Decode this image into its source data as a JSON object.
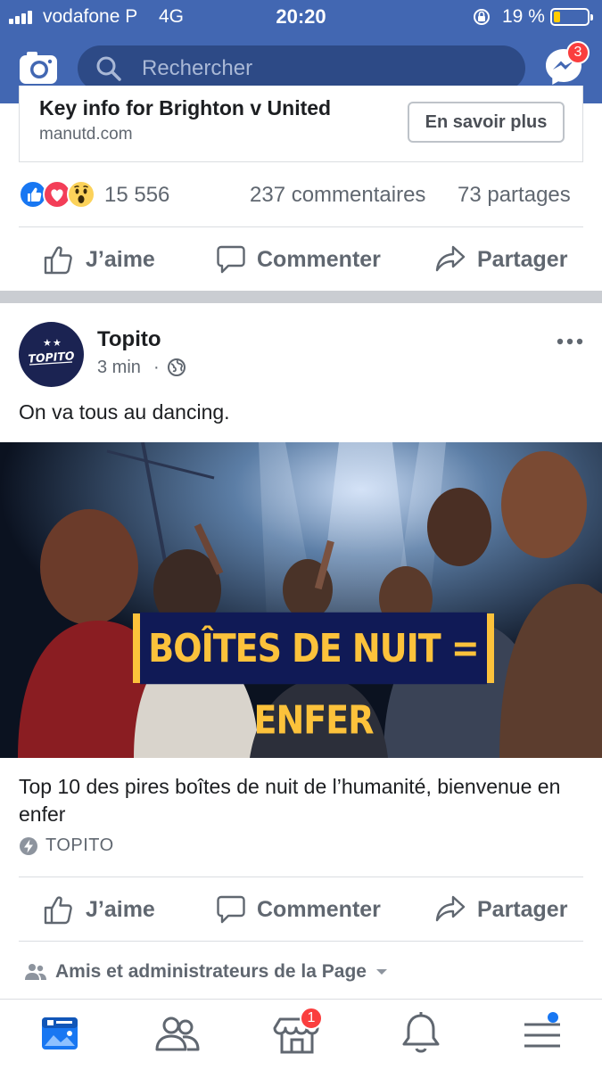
{
  "status_bar": {
    "carrier": "vodafone P",
    "network": "4G",
    "time": "20:20",
    "battery_percent": "19 %",
    "battery_level": 0.19
  },
  "header": {
    "search_placeholder": "Rechercher",
    "messenger_badge": "3",
    "bar_color": "#4267b2"
  },
  "previous_post": {
    "link_title": "Key info for Brighton v United",
    "link_domain": "manutd.com",
    "cta_label": "En savoir plus",
    "reaction_icons": [
      "like",
      "love",
      "wow"
    ],
    "reaction_count": "15 556",
    "comments": "237 commentaires",
    "shares": "73 partages",
    "actions": {
      "like": "J’aime",
      "comment": "Commenter",
      "share": "Partager"
    }
  },
  "post": {
    "page_name": "Topito",
    "avatar_text": "TOPITO",
    "time": "3 min",
    "separator": "·",
    "privacy_icon": "globe-icon",
    "text": "On va tous au dancing.",
    "image_headline": "BOÎTES DE NUIT = ENFER",
    "article_title": "Top 10 des pires boîtes de nuit de l’humanité, bienvenue en enfer",
    "source": "TOPITO",
    "actions": {
      "like": "J’aime",
      "comment": "Commenter",
      "share": "Partager"
    },
    "audience": "Amis et administrateurs de la Page"
  },
  "tabbar": {
    "tabs": [
      "news-feed",
      "friends",
      "marketplace",
      "notifications",
      "menu"
    ],
    "marketplace_badge": "1"
  }
}
